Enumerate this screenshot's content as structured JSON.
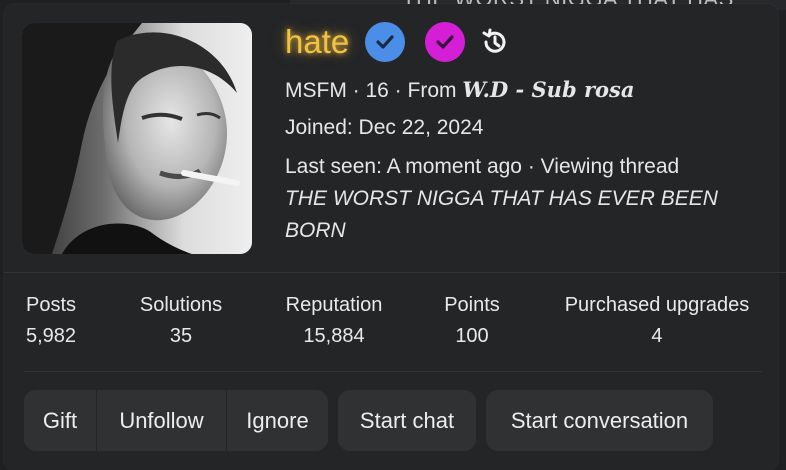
{
  "background": {
    "partial_text": "THE WORST NIGGA THAT HAS"
  },
  "profile": {
    "username": "hate",
    "username_color": "#f3c243",
    "badges": [
      {
        "icon": "check-icon",
        "color": "#4a8ee8"
      },
      {
        "icon": "check-icon",
        "color": "#d41fd6"
      },
      {
        "icon": "history-icon"
      }
    ],
    "subtitle_prefix": "MSFM · 16 · From ",
    "subtitle_location": "W.D - Sub rosa",
    "joined": "Joined: Dec 22, 2024",
    "last_seen": "Last seen: A moment ago · Viewing thread",
    "thread_line1": "THE WORST NIGGA THAT HAS EVER BEEN",
    "thread_line2": "BORN"
  },
  "stats": [
    {
      "label": "Posts",
      "value": "5,982"
    },
    {
      "label": "Solutions",
      "value": "35"
    },
    {
      "label": "Reputation",
      "value": "15,884"
    },
    {
      "label": "Points",
      "value": "100"
    },
    {
      "label": "Purchased upgrades",
      "value": "4"
    }
  ],
  "actions": {
    "gift": "Gift",
    "unfollow": "Unfollow",
    "ignore": "Ignore",
    "start_chat": "Start chat",
    "start_conversation": "Start conversation"
  }
}
